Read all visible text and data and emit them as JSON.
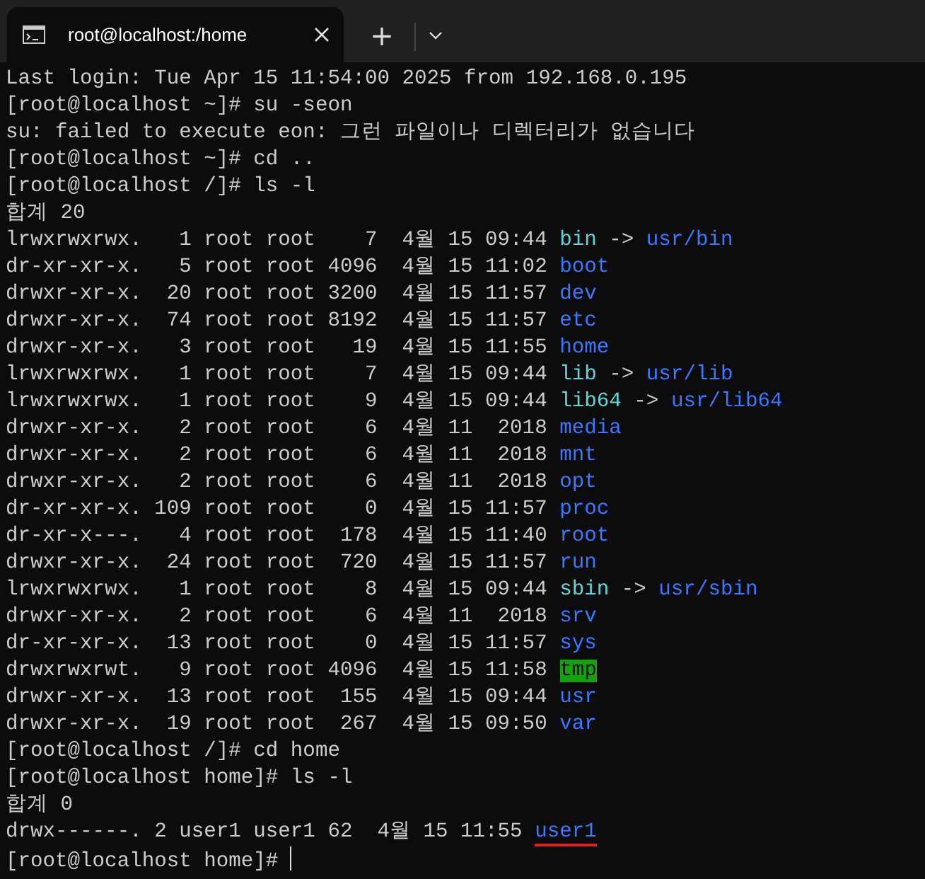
{
  "tab": {
    "title": "root@localhost:/home",
    "selected": true
  },
  "new_tab_label": "+",
  "lines": [
    {
      "text": "Last login: Tue Apr 15 11:54:00 2025 from 192.168.0.195"
    },
    {
      "text": "[root@localhost ~]# su -seon"
    },
    {
      "text": "su: failed to execute eon: 그런 파일이나 디렉터리가 없습니다"
    },
    {
      "text": "[root@localhost ~]# cd .."
    },
    {
      "text": "[root@localhost /]# ls -l"
    },
    {
      "text": "합계 20"
    },
    {
      "text": "lrwxrwxrwx.   1 root root    7  4월 15 09:44 ",
      "name": "bin",
      "kind": "symlink",
      "arrow": "->",
      "target": "usr/bin"
    },
    {
      "text": "dr-xr-xr-x.   5 root root 4096  4월 15 11:02 ",
      "name": "boot",
      "kind": "dir"
    },
    {
      "text": "drwxr-xr-x.  20 root root 3200  4월 15 11:57 ",
      "name": "dev",
      "kind": "dir"
    },
    {
      "text": "drwxr-xr-x.  74 root root 8192  4월 15 11:57 ",
      "name": "etc",
      "kind": "dir"
    },
    {
      "text": "drwxr-xr-x.   3 root root   19  4월 15 11:55 ",
      "name": "home",
      "kind": "dir"
    },
    {
      "text": "lrwxrwxrwx.   1 root root    7  4월 15 09:44 ",
      "name": "lib",
      "kind": "symlink",
      "arrow": "->",
      "target": "usr/lib"
    },
    {
      "text": "lrwxrwxrwx.   1 root root    9  4월 15 09:44 ",
      "name": "lib64",
      "kind": "symlink",
      "arrow": "->",
      "target": "usr/lib64"
    },
    {
      "text": "drwxr-xr-x.   2 root root    6  4월 11  2018 ",
      "name": "media",
      "kind": "dir"
    },
    {
      "text": "drwxr-xr-x.   2 root root    6  4월 11  2018 ",
      "name": "mnt",
      "kind": "dir"
    },
    {
      "text": "drwxr-xr-x.   2 root root    6  4월 11  2018 ",
      "name": "opt",
      "kind": "dir"
    },
    {
      "text": "dr-xr-xr-x. 109 root root    0  4월 15 11:57 ",
      "name": "proc",
      "kind": "dir"
    },
    {
      "text": "dr-xr-x---.   4 root root  178  4월 15 11:40 ",
      "name": "root",
      "kind": "dir"
    },
    {
      "text": "drwxr-xr-x.  24 root root  720  4월 15 11:57 ",
      "name": "run",
      "kind": "dir"
    },
    {
      "text": "lrwxrwxrwx.   1 root root    8  4월 15 09:44 ",
      "name": "sbin",
      "kind": "symlink",
      "arrow": "->",
      "target": "usr/sbin"
    },
    {
      "text": "drwxr-xr-x.   2 root root    6  4월 11  2018 ",
      "name": "srv",
      "kind": "dir"
    },
    {
      "text": "dr-xr-xr-x.  13 root root    0  4월 15 11:57 ",
      "name": "sys",
      "kind": "dir"
    },
    {
      "text": "drwxrwxrwt.   9 root root 4096  4월 15 11:58 ",
      "name": "tmp",
      "kind": "sticky"
    },
    {
      "text": "drwxr-xr-x.  13 root root  155  4월 15 09:44 ",
      "name": "usr",
      "kind": "dir"
    },
    {
      "text": "drwxr-xr-x.  19 root root  267  4월 15 09:50 ",
      "name": "var",
      "kind": "dir"
    },
    {
      "text": "[root@localhost /]# cd home"
    },
    {
      "text": "[root@localhost home]# ls -l"
    },
    {
      "text": "합계 0"
    },
    {
      "text": "drwx------. 2 user1 user1 62  4월 15 11:55 ",
      "name": "user1",
      "kind": "dir",
      "underlined": true
    },
    {
      "text": "[root@localhost home]# ",
      "cursor": true
    }
  ]
}
